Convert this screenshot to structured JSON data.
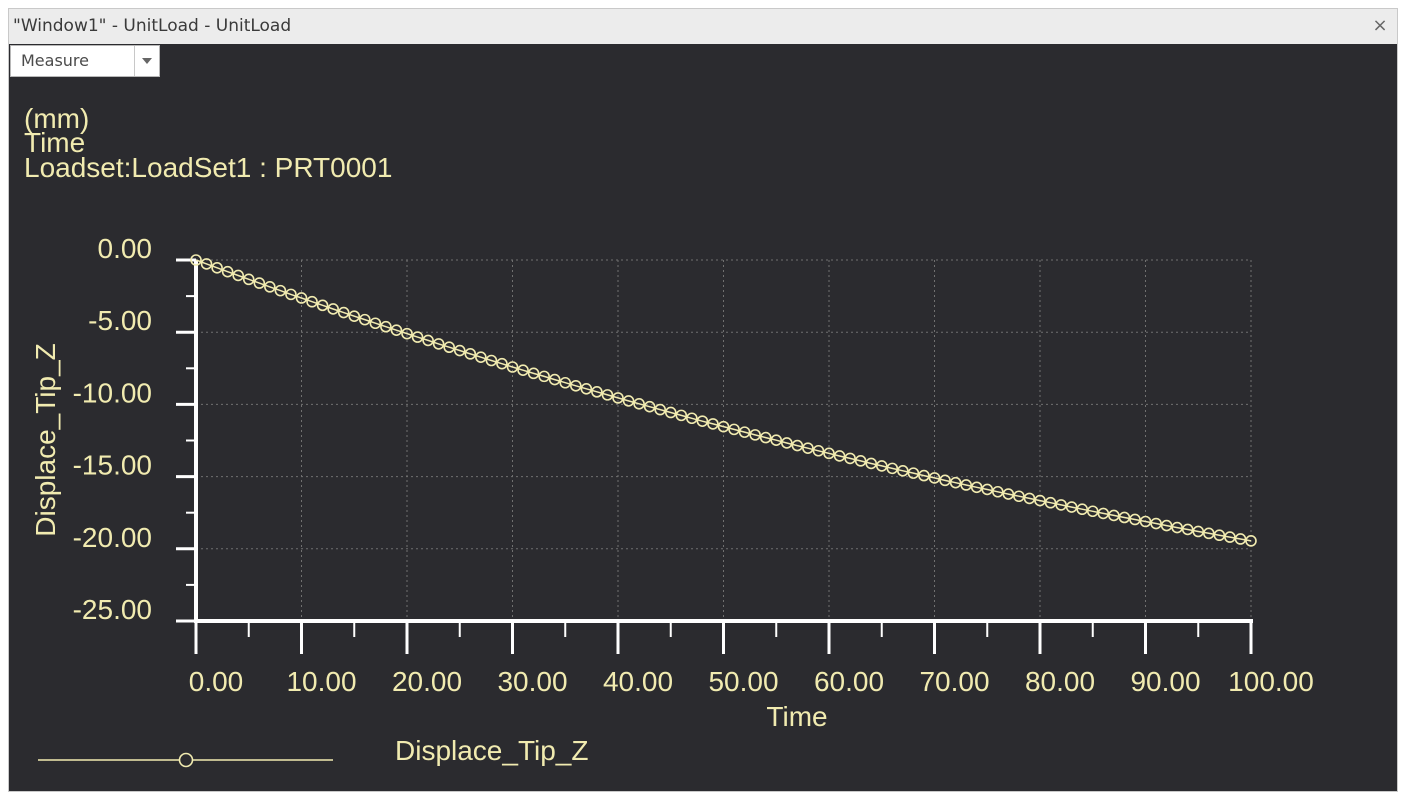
{
  "window": {
    "title": "\"Window1\" - UnitLoad - UnitLoad",
    "close_glyph": "×"
  },
  "toolbar": {
    "measure_label": "Measure"
  },
  "colors": {
    "background": "#2b2b2f",
    "text": "#f1ebb0",
    "axis": "#ffffff",
    "grid": "#707070",
    "series": "#f1ebb0"
  },
  "chart_data": {
    "type": "line",
    "header_lines": [
      "(mm)",
      "Time",
      "Loadset:LoadSet1 :  PRT0001"
    ],
    "xlabel": "Time",
    "ylabel": "Displace_Tip_Z",
    "xlim": [
      0,
      100
    ],
    "ylim": [
      -25,
      0
    ],
    "x_ticks": [
      "0.00",
      "10.00",
      "20.00",
      "30.00",
      "40.00",
      "50.00",
      "60.00",
      "70.00",
      "80.00",
      "90.00",
      "100.00"
    ],
    "y_ticks": [
      "0.00",
      "-5.00",
      "-10.00",
      "-15.00",
      "-20.00",
      "-25.00"
    ],
    "grid": true,
    "legend_position": "bottom-left",
    "series": [
      {
        "name": "Displace_Tip_Z",
        "marker": "circle",
        "x": [
          0,
          1,
          2,
          3,
          4,
          5,
          6,
          7,
          8,
          9,
          10,
          11,
          12,
          13,
          14,
          15,
          16,
          17,
          18,
          19,
          20,
          21,
          22,
          23,
          24,
          25,
          26,
          27,
          28,
          29,
          30,
          31,
          32,
          33,
          34,
          35,
          36,
          37,
          38,
          39,
          40,
          41,
          42,
          43,
          44,
          45,
          46,
          47,
          48,
          49,
          50,
          51,
          52,
          53,
          54,
          55,
          56,
          57,
          58,
          59,
          60,
          61,
          62,
          63,
          64,
          65,
          66,
          67,
          68,
          69,
          70,
          71,
          72,
          73,
          74,
          75,
          76,
          77,
          78,
          79,
          80,
          81,
          82,
          83,
          84,
          85,
          86,
          87,
          88,
          89,
          90,
          91,
          92,
          93,
          94,
          95,
          96,
          97,
          98,
          99,
          100
        ],
        "y": [
          0,
          -0.27,
          -0.54,
          -0.81,
          -1.07,
          -1.34,
          -1.6,
          -1.86,
          -2.12,
          -2.38,
          -2.63,
          -2.89,
          -3.14,
          -3.39,
          -3.64,
          -3.89,
          -4.13,
          -4.38,
          -4.62,
          -4.86,
          -5.1,
          -5.34,
          -5.57,
          -5.81,
          -6.04,
          -6.27,
          -6.5,
          -6.73,
          -6.96,
          -7.18,
          -7.41,
          -7.63,
          -7.85,
          -8.06,
          -8.28,
          -8.5,
          -8.71,
          -8.92,
          -9.13,
          -9.34,
          -9.55,
          -9.76,
          -9.96,
          -10.16,
          -10.36,
          -10.56,
          -10.76,
          -10.96,
          -11.16,
          -11.35,
          -11.54,
          -11.73,
          -11.92,
          -12.11,
          -12.3,
          -12.48,
          -12.67,
          -12.85,
          -13.03,
          -13.21,
          -13.39,
          -13.57,
          -13.74,
          -13.91,
          -14.09,
          -14.26,
          -14.43,
          -14.6,
          -14.76,
          -14.93,
          -15.09,
          -15.26,
          -15.42,
          -15.58,
          -15.74,
          -15.89,
          -16.05,
          -16.21,
          -16.36,
          -16.51,
          -16.66,
          -16.81,
          -16.96,
          -17.11,
          -17.26,
          -17.4,
          -17.55,
          -17.69,
          -17.83,
          -17.97,
          -18.11,
          -18.25,
          -18.39,
          -18.53,
          -18.66,
          -18.8,
          -18.93,
          -19.06,
          -19.19,
          -19.32,
          -19.45
        ]
      }
    ]
  }
}
